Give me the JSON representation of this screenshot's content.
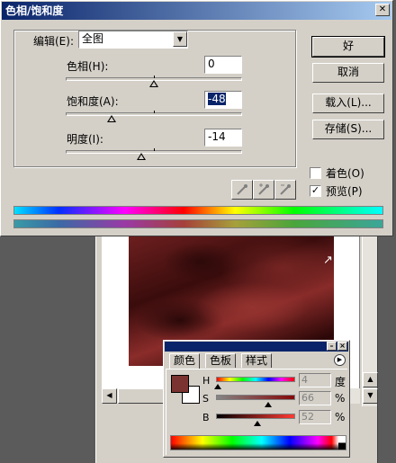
{
  "dialog": {
    "title": "色相/饱和度",
    "close_glyph": "✕",
    "edit_label": "编辑(E):",
    "edit_value": "全图",
    "hue_label": "色相(H):",
    "hue_value": "0",
    "saturation_label": "饱和度(A):",
    "saturation_value": "-48",
    "lightness_label": "明度(I):",
    "lightness_value": "-14",
    "sliders": {
      "hue_fraction": 0.5,
      "saturation_fraction": 0.26,
      "lightness_fraction": 0.43
    },
    "buttons": {
      "ok": "好",
      "cancel": "取消",
      "load": "载入(L)...",
      "save": "存储(S)..."
    },
    "colorize_label": "着色(O)",
    "colorize_checked": false,
    "preview_label": "预览(P)",
    "preview_checked": true,
    "preview_mark": "✓"
  },
  "palette": {
    "tabs": [
      "颜色",
      "色板",
      "样式"
    ],
    "active_tab": 0,
    "channels": [
      {
        "label": "H",
        "value": "4",
        "unit": "度"
      },
      {
        "label": "S",
        "value": "66",
        "unit": "%"
      },
      {
        "label": "B",
        "value": "52",
        "unit": "%"
      }
    ],
    "foreground_color": "#7b3331",
    "background_color": "#ffffff"
  },
  "document": {
    "scroll_up": "▲",
    "scroll_down": "▼",
    "scroll_left": "◀"
  },
  "colors": {
    "titlebar": "#0a246a",
    "dialog_face": "#d4d0c8"
  }
}
